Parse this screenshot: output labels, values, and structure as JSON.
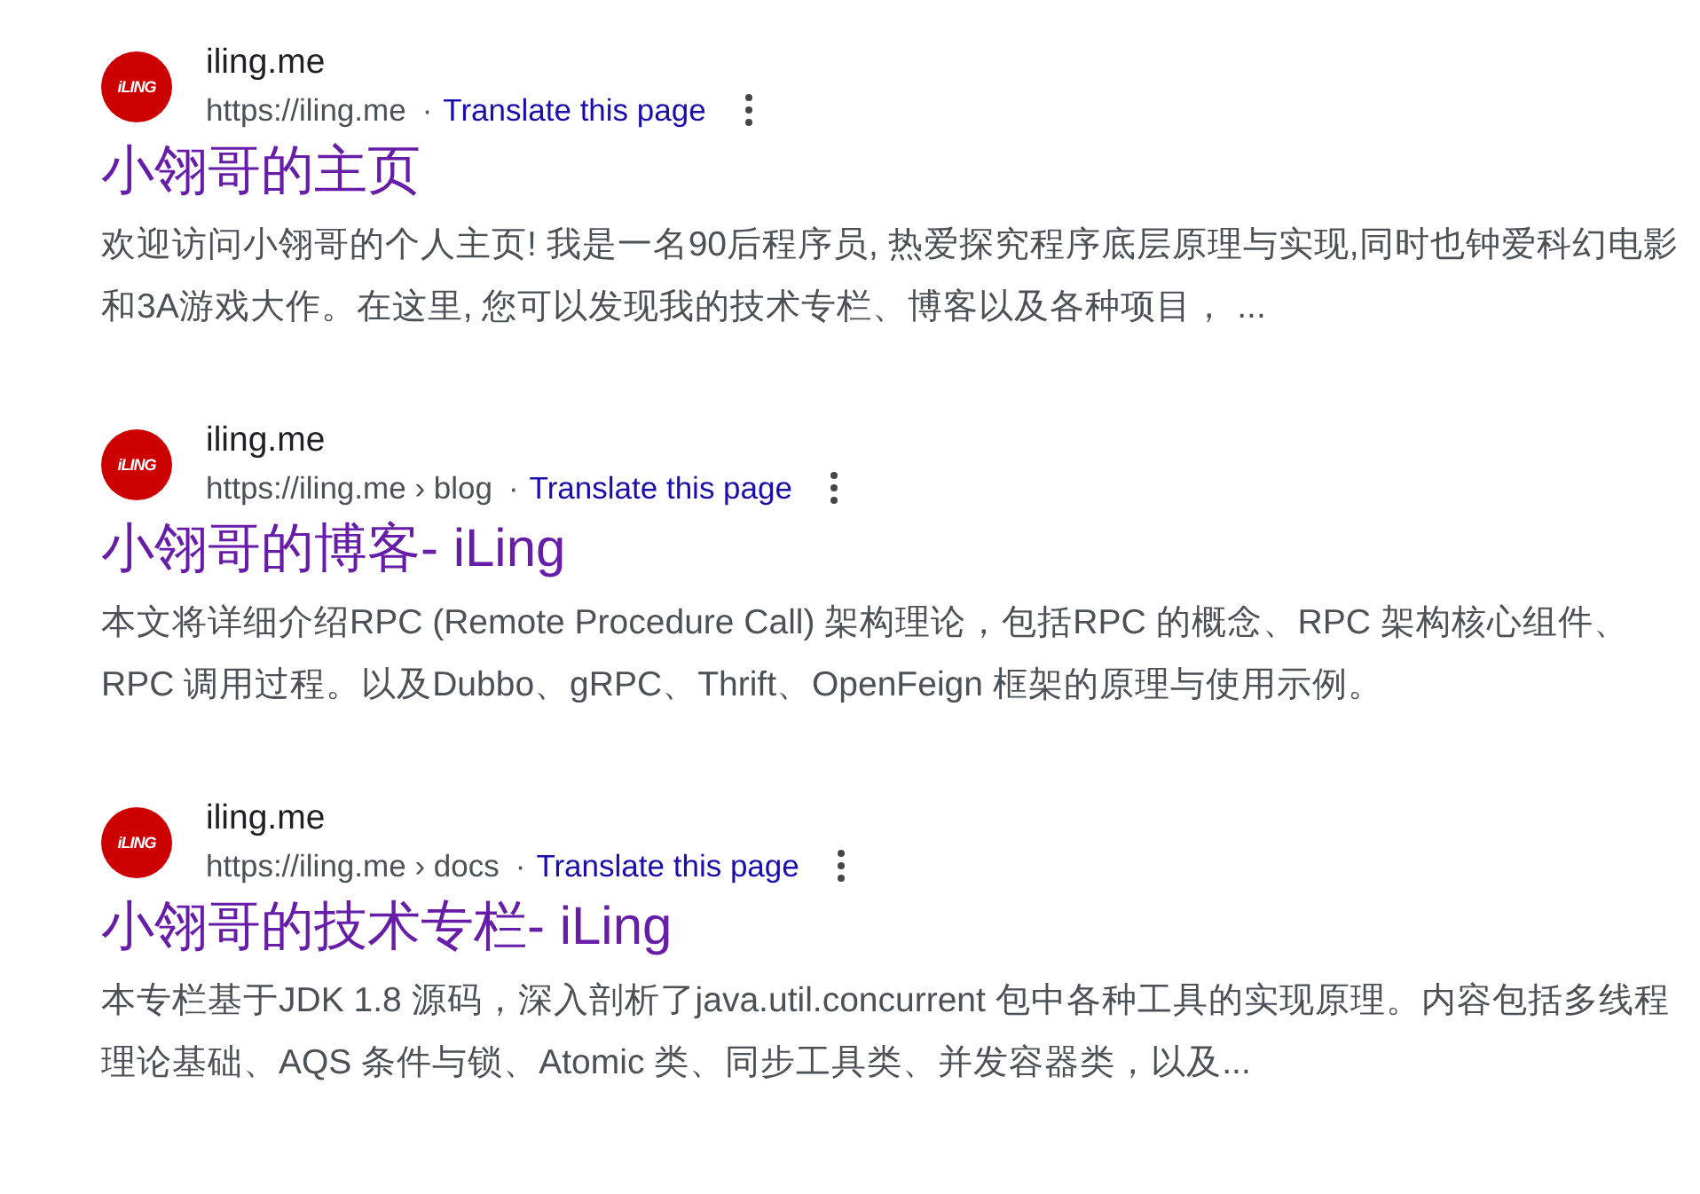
{
  "results": [
    {
      "logo_text": "iLING",
      "site_name": "iling.me",
      "url": "https://iling.me",
      "separator": "·",
      "translate_link": "Translate this page",
      "title": "小翎哥的主页",
      "snippet": "欢迎访问小翎哥的个人主页! 我是一名90后程序员, 热爱探究程序底层原理与实现,同时也钟爱科幻电影和3A游戏大作。在这里, 您可以发现我的技术专栏、博客以及各种项目，  ..."
    },
    {
      "logo_text": "iLING",
      "site_name": "iling.me",
      "url": "https://iling.me",
      "breadcrumb": "› blog",
      "separator": "·",
      "translate_link": "Translate this page",
      "title": "小翎哥的博客- iLing",
      "snippet": "本文将详细介绍RPC (Remote Procedure Call) 架构理论，包括RPC 的概念、RPC 架构核心组件、RPC 调用过程。以及Dubbo、gRPC、Thrift、OpenFeign 框架的原理与使用示例。"
    },
    {
      "logo_text": "iLING",
      "site_name": "iling.me",
      "url": "https://iling.me",
      "breadcrumb": "› docs",
      "separator": "·",
      "translate_link": "Translate this page",
      "title": "小翎哥的技术专栏- iLing",
      "snippet": "本专栏基于JDK 1.8 源码，深入剖析了java.util.concurrent 包中各种工具的实现原理。内容包括多线程理论基础、AQS 条件与锁、Atomic 类、同步工具类、并发容器类，以及..."
    }
  ]
}
